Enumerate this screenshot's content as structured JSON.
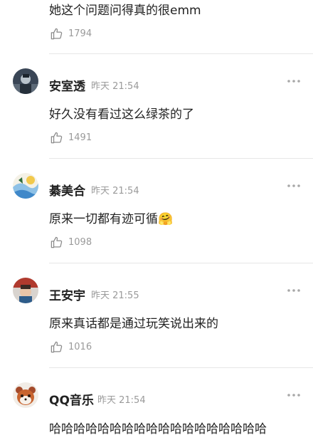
{
  "partial_comment": {
    "content": "她这个问题问得真的很emm",
    "likes": "1794"
  },
  "comments": [
    {
      "name": "安室透",
      "time": "昨天 21:54",
      "content": "好久没有看过这么绿茶的了",
      "emoji": "",
      "likes": "1491"
    },
    {
      "name": "綦美合",
      "time": "昨天 21:54",
      "content": "原来一切都有迹可循",
      "emoji": "🤗",
      "likes": "1098"
    },
    {
      "name": "王安宇",
      "time": "昨天 21:55",
      "content": "原来真话都是通过玩笑说出来的",
      "emoji": "",
      "likes": "1016"
    },
    {
      "name": "QQ音乐",
      "time": "昨天 21:54",
      "content": "哈哈哈哈哈哈哈哈哈哈哈哈哈哈哈哈哈哈"
    }
  ],
  "icons": {
    "like": "thumbs-up-icon",
    "more": "more-dots-icon"
  },
  "colors": {
    "text": "#222222",
    "meta": "#9a9a9a",
    "divider": "#e6e6e6"
  }
}
